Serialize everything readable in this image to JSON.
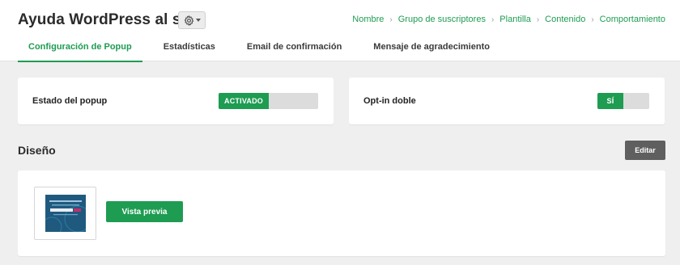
{
  "header": {
    "title": "Ayuda WordPress al salir",
    "gear_icon": "gear-icon"
  },
  "breadcrumb": [
    "Nombre",
    "Grupo de suscriptores",
    "Plantilla",
    "Contenido",
    "Comportamiento"
  ],
  "tabs": [
    {
      "label": "Configuración de Popup",
      "active": true
    },
    {
      "label": "Estadísticas",
      "active": false
    },
    {
      "label": "Email de confirmación",
      "active": false
    },
    {
      "label": "Mensaje de agradecimiento",
      "active": false
    }
  ],
  "status_card": {
    "label": "Estado del popup",
    "toggle_label": "ACTIVADO",
    "enabled": true
  },
  "optin_card": {
    "label": "Opt-in doble",
    "toggle_label": "SÍ",
    "enabled": true
  },
  "design": {
    "title": "Diseño",
    "edit_label": "Editar",
    "preview_label": "Vista previa"
  },
  "colors": {
    "accent": "#1e9c52",
    "edit_button": "#5f5f5f",
    "background": "#efefef"
  }
}
